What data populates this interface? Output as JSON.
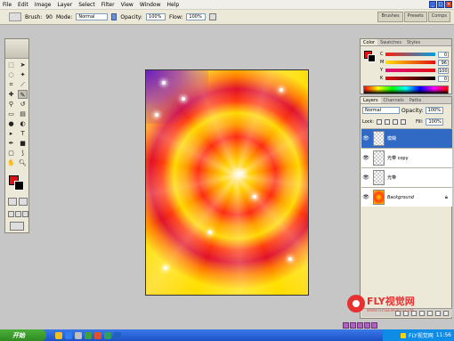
{
  "menu": [
    "File",
    "Edit",
    "Image",
    "Layer",
    "Select",
    "Filter",
    "View",
    "Window",
    "Help"
  ],
  "options": {
    "brush_label": "Brush:",
    "brush_size": "90",
    "mode_label": "Mode:",
    "mode_value": "Normal",
    "opacity_label": "Opacity:",
    "opacity_value": "100%",
    "flow_label": "Flow:",
    "flow_value": "100%"
  },
  "palette_well": [
    "Brushes",
    "Presets",
    "Comps"
  ],
  "color_panel": {
    "tabs": [
      "Color",
      "Swatches",
      "Styles"
    ],
    "rows": [
      {
        "key": "C",
        "value": "0"
      },
      {
        "key": "M",
        "value": "96"
      },
      {
        "key": "Y",
        "value": "100"
      },
      {
        "key": "K",
        "value": "0"
      }
    ],
    "colors": {
      "foreground": "#e01010",
      "background": "#000000"
    }
  },
  "layers_panel": {
    "tabs": [
      "Layers",
      "Channels",
      "Paths"
    ],
    "blend_mode": "Normal",
    "opacity_label": "Opacity:",
    "opacity_value": "100%",
    "lock_label": "Lock:",
    "fill_label": "Fill:",
    "fill_value": "100%",
    "layers": [
      {
        "name": "模糊",
        "selected": true
      },
      {
        "name": "光带 copy",
        "selected": false
      },
      {
        "name": "光带",
        "selected": false
      },
      {
        "name": "Background",
        "selected": false
      }
    ]
  },
  "watermark": {
    "title": "FLY视觉网",
    "url": "WWW.FLYSEEWORLD.COM"
  },
  "taskbar": {
    "start_label": "开始",
    "tray_time": "11:56",
    "tray_text": "FLY视觉网"
  }
}
